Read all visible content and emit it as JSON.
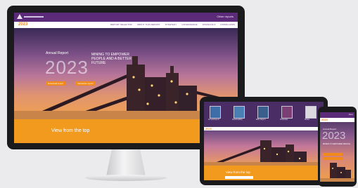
{
  "site": {
    "year_tag": "2023",
    "utility_label": "Other reports",
    "nav": [
      "REPORT SELECTOR",
      "ABOUT THIS REPORT",
      "STRATEGY",
      "GOVERNANCE",
      "FINANCIALS",
      "DOWNLOADS"
    ]
  },
  "hero": {
    "report_label": "Annual Report",
    "year": "2023",
    "tagline": "Mining to empower people and a better future",
    "cta_primary": "Download report",
    "cta_secondary": "Interactive report"
  },
  "strip": {
    "title": "View from the top"
  },
  "tablet": {
    "thumbs": [
      {
        "caption": "Annual Report",
        "color": "#3e6ea8"
      },
      {
        "caption": "Sustainability",
        "color": "#4a7fb3"
      },
      {
        "caption": "ESG Report",
        "color": "#3a5f8d"
      },
      {
        "caption": "Financials",
        "color": "#7b3f76"
      },
      {
        "caption": "Notice",
        "color": "#d9d9de"
      }
    ],
    "strip_title": "View from the top"
  },
  "phone": {
    "utility_label": "Menu",
    "tagline": "Mining to empower people"
  },
  "colors": {
    "brand_purple": "#5b2a78",
    "accent_orange": "#f19a1e"
  }
}
